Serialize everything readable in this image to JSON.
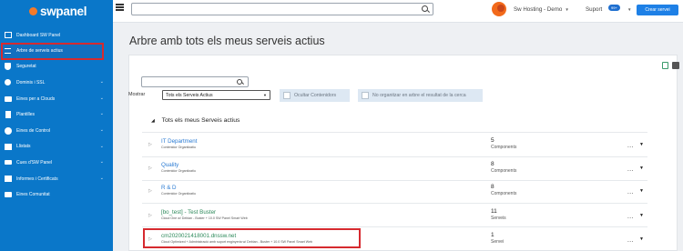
{
  "brand": {
    "name": "swpanel"
  },
  "sidebar": {
    "items": [
      {
        "label": "Dashboard SW Panel",
        "icon": "dashboard-icon",
        "chevron": false
      },
      {
        "label": "Arbre de serveis actius",
        "icon": "list-icon",
        "chevron": false,
        "selected": true
      },
      {
        "label": "Seguretat",
        "icon": "shield-icon",
        "chevron": false
      },
      {
        "label": "Dominis i SSL",
        "icon": "globe-icon",
        "chevron": true
      },
      {
        "label": "Eines per a Clouds",
        "icon": "briefcase-icon",
        "chevron": true
      },
      {
        "label": "Plantilles",
        "icon": "file-icon",
        "chevron": true
      },
      {
        "label": "Eines de Control",
        "icon": "check-circle-icon",
        "chevron": true
      },
      {
        "label": "Llistats",
        "icon": "table-icon",
        "chevron": true
      },
      {
        "label": "Cues d'SW Panel",
        "icon": "layers-icon",
        "chevron": true
      },
      {
        "label": "Informes i Certificats",
        "icon": "report-icon",
        "chevron": true
      },
      {
        "label": "Eines Comunitat",
        "icon": "community-icon",
        "chevron": false
      }
    ]
  },
  "topbar": {
    "account": "Sw Hosting - Demo",
    "support_label": "Suport",
    "support_badge": "99+",
    "create_button": "Crear servei"
  },
  "page": {
    "title": "Arbre amb tots els meus serveis actius"
  },
  "filters": {
    "show_label": "Mostrar",
    "select_value": "Tots els Serveis Actius",
    "hide_containers": "Ocultar Contenidors",
    "no_tree": "No organitzar en arbre el resultat de la cerca"
  },
  "section": {
    "title": "Tots els meus Serveis actius"
  },
  "rows": [
    {
      "name": "IT Department",
      "sub": "Contenidor Organitzatiu",
      "count": "5",
      "count_label": "Components",
      "color": "#2b7bd3"
    },
    {
      "name": "Quality",
      "sub": "Contenidor Organitzatiu",
      "count": "8",
      "count_label": "Components",
      "color": "#2b7bd3"
    },
    {
      "name": "R & D",
      "sub": "Contenidor Organitzatiu",
      "count": "8",
      "count_label": "Components",
      "color": "#2b7bd3"
    },
    {
      "name": "[bo_test] - Test Buster",
      "sub": "Cloud One w/ Debian - Buster + 10.0 SW Panel Smart Web",
      "count": "11",
      "count_label": "Serveis",
      "color": "#2e8a5b"
    },
    {
      "name": "cm2020021418001.dnssw.net",
      "sub": "Cloud Optimized + Administració amb suport enginyeria w/ Debian - Buster + 10.0 SW Panel Smart Web",
      "count": "1",
      "count_label": "Servei",
      "color": "#2e8a5b"
    }
  ],
  "row_actions": {
    "more": "..."
  }
}
